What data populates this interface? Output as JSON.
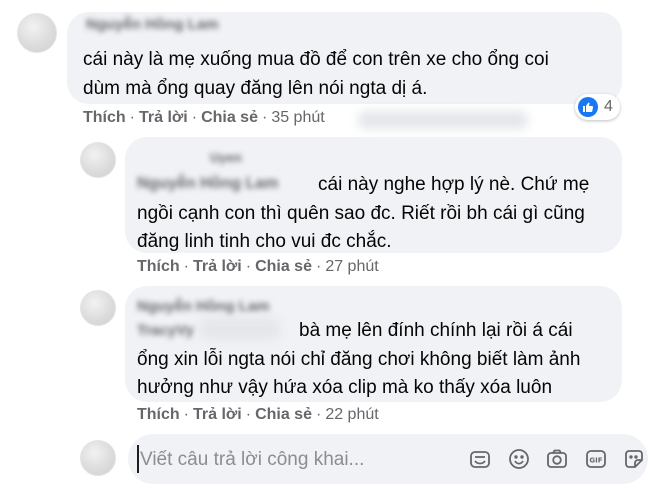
{
  "comments": [
    {
      "text_lines": [
        "cái này là mẹ xuống mua đồ để con trên xe cho ổng coi",
        "dùm mà ổng quay đăng lên nói ngta dị á."
      ],
      "actions": {
        "like": "Thích",
        "reply": "Trả lời",
        "share": "Chia sẻ",
        "sep": "·",
        "time": "35 phút"
      },
      "reaction_count": "4"
    },
    {
      "text_lines": [
        "cái này nghe hợp lý nè. Chứ mẹ",
        "ngồi cạnh con thì quên sao đc. Riết rồi bh cái gì cũng",
        "đăng linh tinh cho vui đc chắc."
      ],
      "actions": {
        "like": "Thích",
        "reply": "Trả lời",
        "share": "Chia sẻ",
        "sep": "·",
        "time": "27 phút"
      }
    },
    {
      "text_lines": [
        "bà mẹ lên đính chính lại rồi á cái",
        "ổng xin lỗi ngta nói chỉ đăng chơi không biết làm ảnh",
        "hưởng như vậy hứa xóa clip mà ko thấy xóa luôn"
      ],
      "actions": {
        "like": "Thích",
        "reply": "Trả lời",
        "share": "Chia sẻ",
        "sep": "·",
        "time": "22 phút"
      }
    }
  ],
  "reply_box": {
    "placeholder": "Viết câu trả lời công khai...",
    "icons": [
      "sticker-face-icon",
      "emoji-icon",
      "camera-icon",
      "gif-icon",
      "sticker-icon"
    ]
  },
  "colors": {
    "bubble": "#f0f2f5",
    "meta_text": "#65676b",
    "like_blue": "#1877f2"
  }
}
